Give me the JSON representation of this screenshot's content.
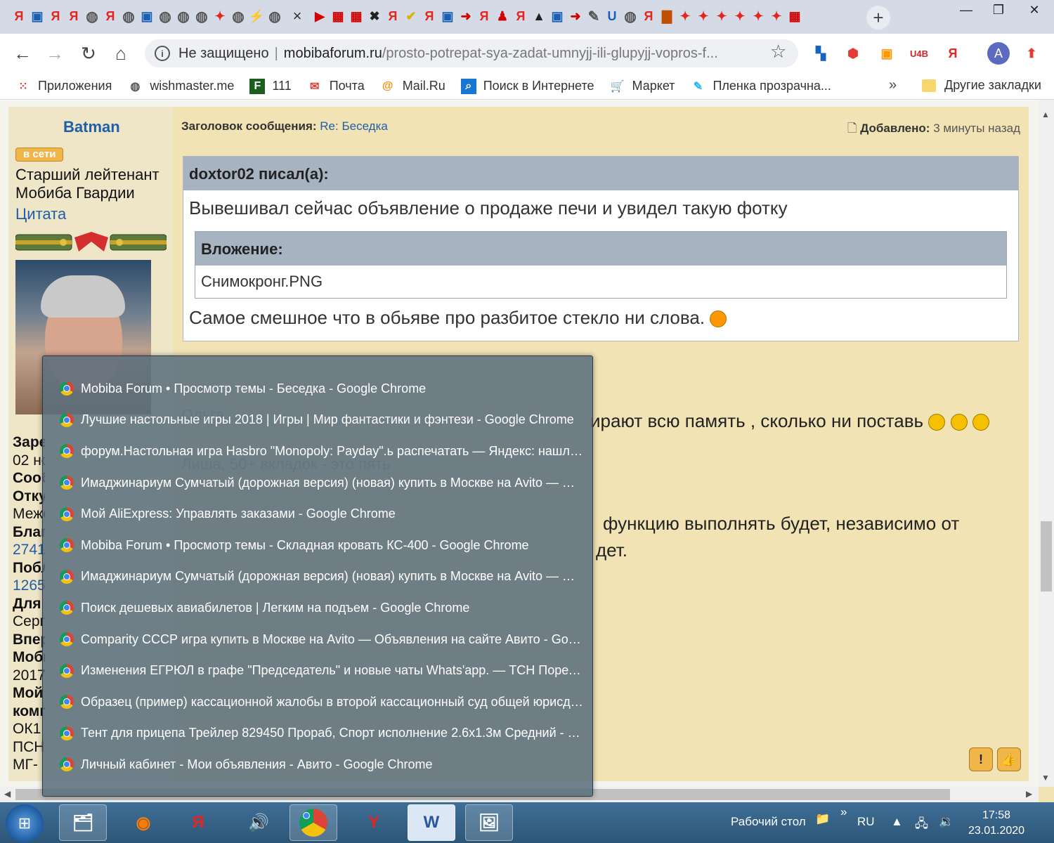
{
  "browser": {
    "not_secure_label": "Не защищено",
    "url_host": "mobibaforum.ru",
    "url_path": "/prosto-potrepat-sya-zadat-umnyjj-ili-glupyjj-vopros-f...",
    "avatar_letter": "A",
    "tab_close": "×",
    "new_tab": "+"
  },
  "bookmarks": {
    "items": [
      {
        "label": "Приложения",
        "icon": "apps-grid-icon"
      },
      {
        "label": "wishmaster.me",
        "icon": "globe-icon"
      },
      {
        "label": "111",
        "icon": "f-logo-icon"
      },
      {
        "label": "Почта",
        "icon": "mail-envelope-icon"
      },
      {
        "label": "Mail.Ru",
        "icon": "mailru-at-icon"
      },
      {
        "label": "Поиск в Интернете",
        "icon": "search-icon"
      },
      {
        "label": "Маркет",
        "icon": "cart-icon"
      },
      {
        "label": "Пленка прозрачна...",
        "icon": "brush-icon"
      }
    ],
    "more": "»",
    "other": "Другие закладки"
  },
  "profile": {
    "username": "Batman",
    "online_badge": "в сети",
    "rank_line1": "Старший лейтенант",
    "rank_line2": "Мобиба Гвардии",
    "quote_link": "Цитата",
    "stats": [
      {
        "text": "Зарегистрирован:",
        "bold": true
      },
      {
        "text": "02 ноября 2017",
        "bold": false
      },
      {
        "text": "Сообщения:",
        "bold": true
      },
      {
        "text": "Откуда:",
        "bold": true
      },
      {
        "text": "Межевой",
        "bold": false
      },
      {
        "text": "Благодарил(а):",
        "bold": true
      },
      {
        "text": "2741 раз",
        "bold": false,
        "link": true
      },
      {
        "text": "Поблагодарили:",
        "bold": true
      },
      {
        "text": "1265 раз",
        "bold": false,
        "link": true
      },
      {
        "text": "Для связи:",
        "bold": true
      },
      {
        "text": "Сергей",
        "bold": false
      },
      {
        "text": "Вперёд",
        "bold": true
      },
      {
        "text": "Мобиба",
        "bold": true
      },
      {
        "text": "2017",
        "bold": false
      },
      {
        "text": "Мой",
        "bold": true
      },
      {
        "text": "комплект: РБ-1Ф",
        "bold": true
      },
      {
        "text": "ОК1",
        "bold": false
      },
      {
        "text": "ПСН",
        "bold": false
      },
      {
        "text": "МГ-",
        "bold": false
      }
    ]
  },
  "post": {
    "subject_label": "Заголовок сообщения:",
    "subject_value": "Re: Беседка",
    "added_label": "Добавлено:",
    "added_value": "3 минуты назад",
    "quote_author": "doxtor02 писал(а):",
    "quote_text": "Вывешивал сейчас объявление о продаже печи и увидел такую фотку",
    "attachment_label": "Вложение:",
    "attachment_file": "Снимокронг.PNG",
    "quote_text2": "Самое смешное что в обьяве про разбитое стекло ни слова.",
    "line1": "ирают всю память , сколько ни поставь",
    "line2_visible": "функцию выполнять будет, независимо от",
    "line3_visible": "дет.",
    "report_btn": "!",
    "thanks_btn": "👍"
  },
  "window_list": [
    "Mobiba Forum • Просмотр темы - Беседка - Google Chrome",
    "Лучшие настольные игры 2018 | Игры | Мир фантастики и фэнтези - Google Chrome",
    "форум.Настольная игра Hasbro \"Monopoly: Payday\".ь распечатать — Яндекс: нашлось ...",
    "Имаджинариум Сумчатый (дорожная версия) (новая) купить в Москве на Avito — Об...",
    "Мой AliExpress: Управлять заказами - Google Chrome",
    "Mobiba Forum • Просмотр темы - Складная кровать КС-400 - Google Chrome",
    "Имаджинариум Сумчатый (дорожная версия) (новая) купить в Москве на Avito — Об...",
    "Поиск дешевых авиабилетов | Легким на подъем - Google Chrome",
    "Comparity СССР игра купить в Москве на Avito — Объявления на сайте Авито - Googl...",
    "Изменения ЕГРЮЛ в графе \"Председатель\" и новые чаты Whats'app. — ТСН Поречье ...",
    "Образец (пример) кассационной жалобы в второй кассационный суд общей юрисди...",
    "Тент для прицепа Трейлер 829450 Прораб, Спорт исполнение 2.6x1.3м Средний - Go...",
    "Личный кабинет - Мои объявления - Авито - Google Chrome"
  ],
  "taskbar": {
    "desktop_label": "Рабочий стол",
    "lang": "RU",
    "time": "17:58",
    "date": "23.01.2020",
    "apps": [
      {
        "name": "explorer-icon",
        "glyph": "🗂"
      },
      {
        "name": "firefox-icon",
        "glyph": "🦊"
      },
      {
        "name": "yandex-browser-icon",
        "glyph": "Я"
      },
      {
        "name": "volume-app-icon",
        "glyph": "🔊"
      },
      {
        "name": "chrome-icon",
        "glyph": ""
      },
      {
        "name": "yandex-icon",
        "glyph": "Y"
      },
      {
        "name": "word-icon",
        "glyph": "W"
      },
      {
        "name": "photo-viewer-icon",
        "glyph": "🖼"
      }
    ]
  }
}
